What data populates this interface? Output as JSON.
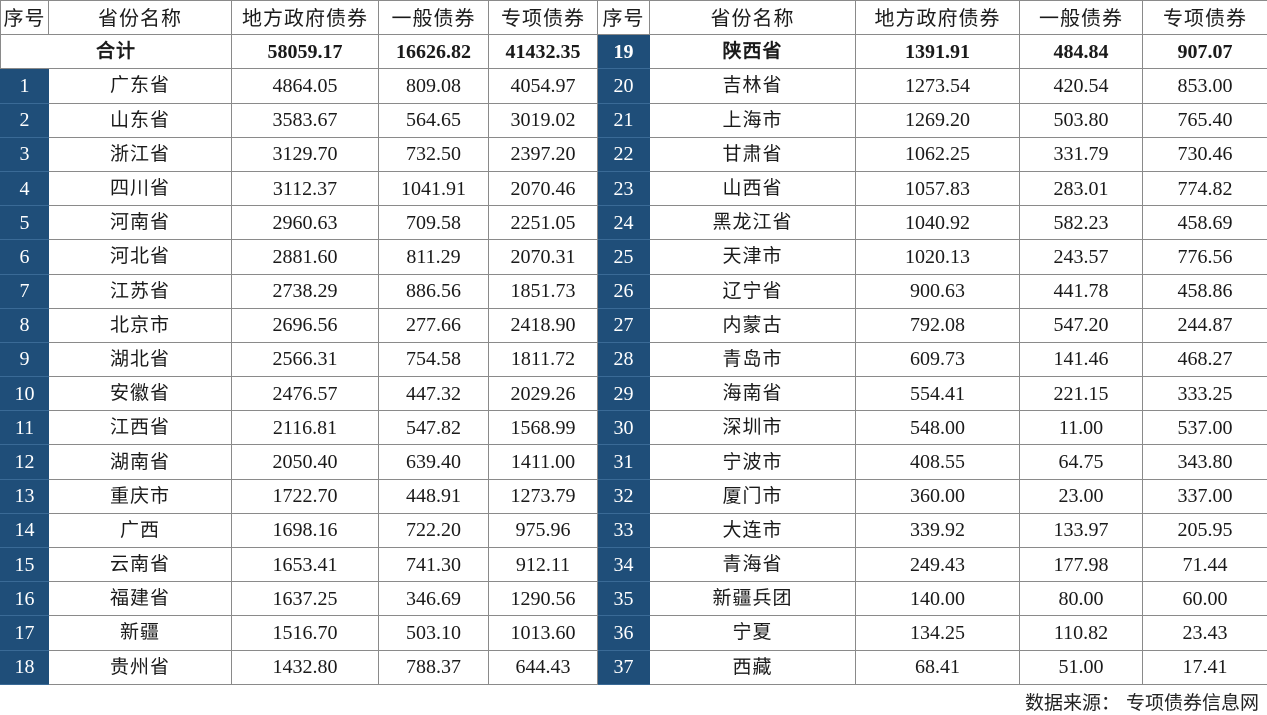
{
  "headers": [
    "序号",
    "省份名称",
    "地方政府债券",
    "一般债券",
    "专项债券"
  ],
  "total": {
    "label": "合计",
    "local": "58059.17",
    "general": "16626.82",
    "special": "41432.35"
  },
  "left_rows": [
    {
      "idx": "1",
      "name": "广东省",
      "local": "4864.05",
      "general": "809.08",
      "special": "4054.97"
    },
    {
      "idx": "2",
      "name": "山东省",
      "local": "3583.67",
      "general": "564.65",
      "special": "3019.02"
    },
    {
      "idx": "3",
      "name": "浙江省",
      "local": "3129.70",
      "general": "732.50",
      "special": "2397.20"
    },
    {
      "idx": "4",
      "name": "四川省",
      "local": "3112.37",
      "general": "1041.91",
      "special": "2070.46"
    },
    {
      "idx": "5",
      "name": "河南省",
      "local": "2960.63",
      "general": "709.58",
      "special": "2251.05"
    },
    {
      "idx": "6",
      "name": "河北省",
      "local": "2881.60",
      "general": "811.29",
      "special": "2070.31"
    },
    {
      "idx": "7",
      "name": "江苏省",
      "local": "2738.29",
      "general": "886.56",
      "special": "1851.73"
    },
    {
      "idx": "8",
      "name": "北京市",
      "local": "2696.56",
      "general": "277.66",
      "special": "2418.90"
    },
    {
      "idx": "9",
      "name": "湖北省",
      "local": "2566.31",
      "general": "754.58",
      "special": "1811.72"
    },
    {
      "idx": "10",
      "name": "安徽省",
      "local": "2476.57",
      "general": "447.32",
      "special": "2029.26"
    },
    {
      "idx": "11",
      "name": "江西省",
      "local": "2116.81",
      "general": "547.82",
      "special": "1568.99"
    },
    {
      "idx": "12",
      "name": "湖南省",
      "local": "2050.40",
      "general": "639.40",
      "special": "1411.00"
    },
    {
      "idx": "13",
      "name": "重庆市",
      "local": "1722.70",
      "general": "448.91",
      "special": "1273.79"
    },
    {
      "idx": "14",
      "name": "广西",
      "local": "1698.16",
      "general": "722.20",
      "special": "975.96"
    },
    {
      "idx": "15",
      "name": "云南省",
      "local": "1653.41",
      "general": "741.30",
      "special": "912.11"
    },
    {
      "idx": "16",
      "name": "福建省",
      "local": "1637.25",
      "general": "346.69",
      "special": "1290.56"
    },
    {
      "idx": "17",
      "name": "新疆",
      "local": "1516.70",
      "general": "503.10",
      "special": "1013.60"
    },
    {
      "idx": "18",
      "name": "贵州省",
      "local": "1432.80",
      "general": "788.37",
      "special": "644.43"
    }
  ],
  "right_rows": [
    {
      "idx": "19",
      "name": "陕西省",
      "local": "1391.91",
      "general": "484.84",
      "special": "907.07"
    },
    {
      "idx": "20",
      "name": "吉林省",
      "local": "1273.54",
      "general": "420.54",
      "special": "853.00"
    },
    {
      "idx": "21",
      "name": "上海市",
      "local": "1269.20",
      "general": "503.80",
      "special": "765.40"
    },
    {
      "idx": "22",
      "name": "甘肃省",
      "local": "1062.25",
      "general": "331.79",
      "special": "730.46"
    },
    {
      "idx": "23",
      "name": "山西省",
      "local": "1057.83",
      "general": "283.01",
      "special": "774.82"
    },
    {
      "idx": "24",
      "name": "黑龙江省",
      "local": "1040.92",
      "general": "582.23",
      "special": "458.69"
    },
    {
      "idx": "25",
      "name": "天津市",
      "local": "1020.13",
      "general": "243.57",
      "special": "776.56"
    },
    {
      "idx": "26",
      "name": "辽宁省",
      "local": "900.63",
      "general": "441.78",
      "special": "458.86"
    },
    {
      "idx": "27",
      "name": "内蒙古",
      "local": "792.08",
      "general": "547.20",
      "special": "244.87"
    },
    {
      "idx": "28",
      "name": "青岛市",
      "local": "609.73",
      "general": "141.46",
      "special": "468.27"
    },
    {
      "idx": "29",
      "name": "海南省",
      "local": "554.41",
      "general": "221.15",
      "special": "333.25"
    },
    {
      "idx": "30",
      "name": "深圳市",
      "local": "548.00",
      "general": "11.00",
      "special": "537.00"
    },
    {
      "idx": "31",
      "name": "宁波市",
      "local": "408.55",
      "general": "64.75",
      "special": "343.80"
    },
    {
      "idx": "32",
      "name": "厦门市",
      "local": "360.00",
      "general": "23.00",
      "special": "337.00"
    },
    {
      "idx": "33",
      "name": "大连市",
      "local": "339.92",
      "general": "133.97",
      "special": "205.95"
    },
    {
      "idx": "34",
      "name": "青海省",
      "local": "249.43",
      "general": "177.98",
      "special": "71.44"
    },
    {
      "idx": "35",
      "name": "新疆兵团",
      "local": "140.00",
      "general": "80.00",
      "special": "60.00"
    },
    {
      "idx": "36",
      "name": "宁夏",
      "local": "134.25",
      "general": "110.82",
      "special": "23.43"
    },
    {
      "idx": "37",
      "name": "西藏",
      "local": "68.41",
      "general": "51.00",
      "special": "17.41"
    }
  ],
  "source": "数据来源： 专项债券信息网",
  "colors": {
    "index_bg": "#1f4e79",
    "index_text": "#ffffff",
    "border": "#8a8a8a"
  }
}
